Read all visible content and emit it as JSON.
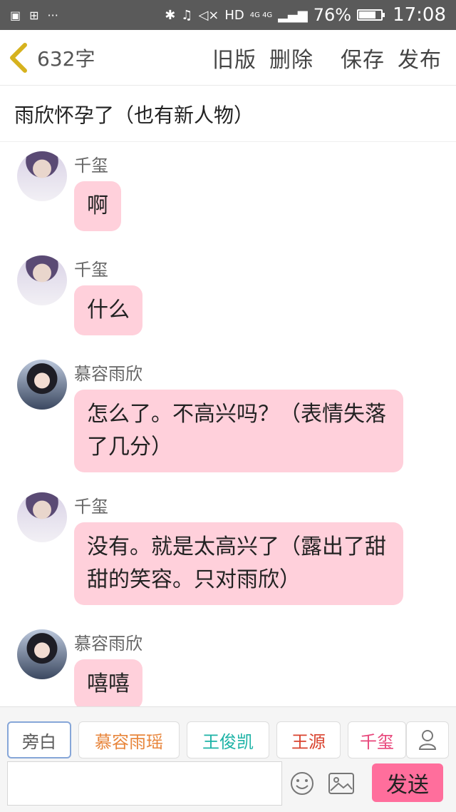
{
  "status": {
    "network": "HD",
    "network_gen": "4G 4G",
    "battery": "76%",
    "battery_fraction": 0.76,
    "time": "17:08"
  },
  "header": {
    "word_count": "632字",
    "actions": [
      "旧版",
      "删除",
      "保存",
      "发布"
    ]
  },
  "chapter_title": "雨欣怀孕了（也有新人物）",
  "messages": [
    {
      "name": "千玺",
      "avatar": "boy",
      "text": "啊"
    },
    {
      "name": "千玺",
      "avatar": "boy",
      "text": "什么"
    },
    {
      "name": "慕容雨欣",
      "avatar": "girl",
      "text": "怎么了。不高兴吗？（表情失落了几分）"
    },
    {
      "name": "千玺",
      "avatar": "boy",
      "text": "没有。就是太高兴了（露出了甜甜的笑容。只对雨欣）"
    },
    {
      "name": "慕容雨欣",
      "avatar": "girl",
      "text": "嘻嘻"
    }
  ],
  "roles": [
    {
      "label": "旁白",
      "color": "#5a5a5a",
      "active": true
    },
    {
      "label": "慕容雨瑶",
      "color": "#e8863c"
    },
    {
      "label": "王俊凯",
      "color": "#1db3a6"
    },
    {
      "label": "王源",
      "color": "#d9432f"
    },
    {
      "label": "千玺",
      "color": "#e8457a"
    }
  ],
  "input": {
    "value": "",
    "placeholder": ""
  },
  "send_label": "发送"
}
